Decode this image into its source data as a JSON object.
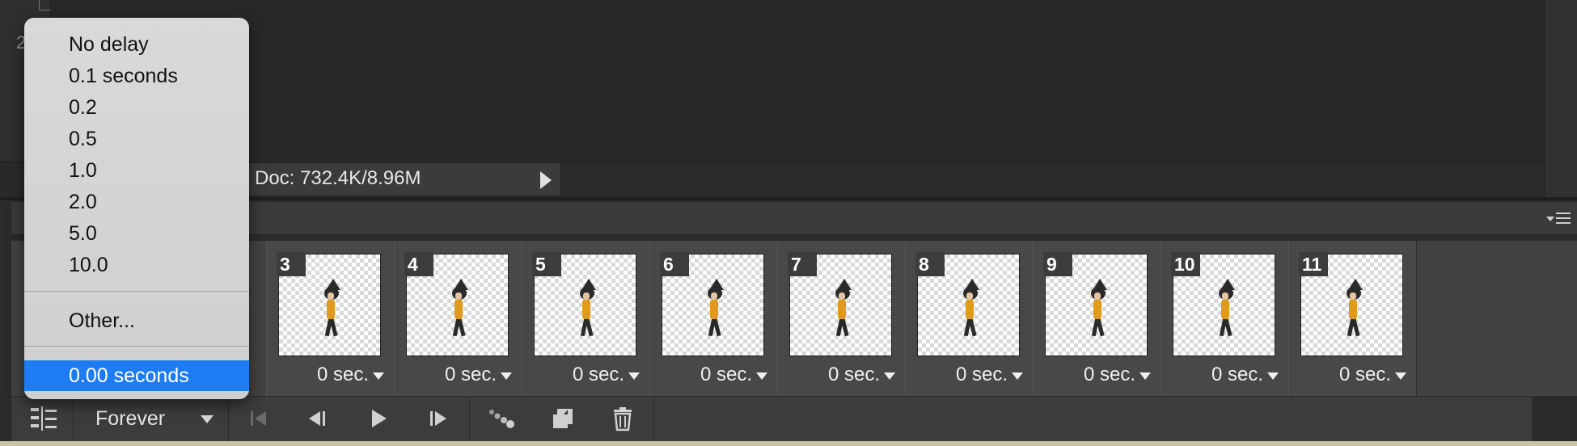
{
  "canvas": {
    "ruler_number": "2",
    "status": {
      "doc_info": "Doc: 732.4K/8.96M"
    }
  },
  "timeline": {
    "frames": [
      {
        "number": "3",
        "delay": "0 sec."
      },
      {
        "number": "4",
        "delay": "0 sec."
      },
      {
        "number": "5",
        "delay": "0 sec."
      },
      {
        "number": "6",
        "delay": "0 sec."
      },
      {
        "number": "7",
        "delay": "0 sec."
      },
      {
        "number": "8",
        "delay": "0 sec."
      },
      {
        "number": "9",
        "delay": "0 sec."
      },
      {
        "number": "10",
        "delay": "0 sec."
      },
      {
        "number": "11",
        "delay": "0 sec."
      }
    ],
    "toolbar": {
      "loop_option": "Forever",
      "icons": [
        "convert-timeline-icon",
        "first-frame-icon",
        "previous-frame-icon",
        "play-icon",
        "next-frame-icon",
        "tween-icon",
        "duplicate-frame-icon",
        "trash-icon"
      ]
    }
  },
  "delay_menu": {
    "items": [
      "No delay",
      "0.1 seconds",
      "0.2",
      "0.5",
      "1.0",
      "2.0",
      "5.0",
      "10.0"
    ],
    "other": "Other...",
    "current": "0.00 seconds"
  },
  "colors": {
    "menu_highlight": "#1d7cf2",
    "figure_shirt": "#e09a1c",
    "panel_bg": "#424242"
  }
}
